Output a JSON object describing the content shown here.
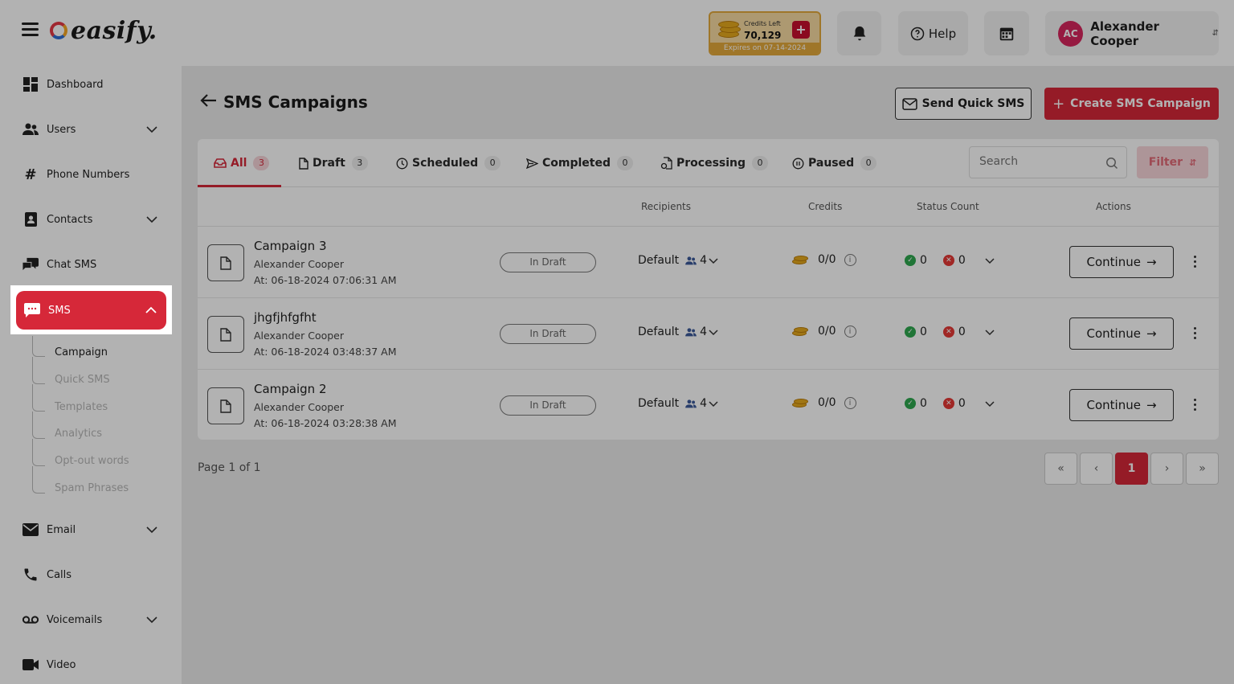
{
  "app": {
    "logo_text": "easify."
  },
  "header": {
    "credits": {
      "label": "Credits Left",
      "value": "70,129",
      "expiry": "Expires on 07-14-2024",
      "add_label": "+"
    },
    "help_label": "Help",
    "user": {
      "initials": "AC",
      "name": "Alexander Cooper"
    }
  },
  "sidebar": {
    "items": [
      {
        "label": "Dashboard",
        "icon": "dashboard-icon"
      },
      {
        "label": "Users",
        "icon": "users-icon"
      },
      {
        "label": "Phone Numbers",
        "icon": "hash-icon"
      },
      {
        "label": "Contacts",
        "icon": "contacts-icon"
      },
      {
        "label": "Chat SMS",
        "icon": "chat-icon"
      },
      {
        "label": "SMS",
        "icon": "sms-icon"
      },
      {
        "label": "Email",
        "icon": "mail-icon"
      },
      {
        "label": "Calls",
        "icon": "phone-icon"
      },
      {
        "label": "Voicemails",
        "icon": "voicemail-icon"
      },
      {
        "label": "Video",
        "icon": "video-icon"
      }
    ],
    "sms_sub": [
      "Campaign",
      "Quick SMS",
      "Templates",
      "Analytics",
      "Opt-out words",
      "Spam Phrases"
    ]
  },
  "main": {
    "title": "SMS Campaigns",
    "send_quick_label": "Send Quick SMS",
    "create_label": "Create SMS Campaign",
    "tabs": [
      {
        "label": "All",
        "count": "3"
      },
      {
        "label": "Draft",
        "count": "3"
      },
      {
        "label": "Scheduled",
        "count": "0"
      },
      {
        "label": "Completed",
        "count": "0"
      },
      {
        "label": "Processing",
        "count": "0"
      },
      {
        "label": "Paused",
        "count": "0"
      }
    ],
    "search_placeholder": "Search",
    "filter_label": "Filter",
    "columns": {
      "recipients": "Recipients",
      "credits": "Credits",
      "status_count": "Status Count",
      "actions": "Actions"
    },
    "rows": [
      {
        "name": "Campaign 3",
        "owner": "Alexander Cooper",
        "date": "At: 06-18-2024 07:06:31 AM",
        "status": "In Draft",
        "recipients_label": "Default",
        "recipients_count": "4",
        "credits": "0/0",
        "ok": "0",
        "err": "0",
        "action": "Continue"
      },
      {
        "name": "jhgfjhfgfht",
        "owner": "Alexander Cooper",
        "date": "At: 06-18-2024 03:48:37 AM",
        "status": "In Draft",
        "recipients_label": "Default",
        "recipients_count": "4",
        "credits": "0/0",
        "ok": "0",
        "err": "0",
        "action": "Continue"
      },
      {
        "name": "Campaign 2",
        "owner": "Alexander Cooper",
        "date": "At: 06-18-2024 03:28:38 AM",
        "status": "In Draft",
        "recipients_label": "Default",
        "recipients_count": "4",
        "credits": "0/0",
        "ok": "0",
        "err": "0",
        "action": "Continue"
      }
    ],
    "pagination": {
      "info": "Page 1 of 1",
      "current": "1",
      "first": "«",
      "prev": "‹",
      "next": "›",
      "last": "»"
    }
  },
  "colors": {
    "accent": "#d62839",
    "success": "#2fa84f",
    "error": "#e53935",
    "credits_gold": "#e4a93c"
  }
}
